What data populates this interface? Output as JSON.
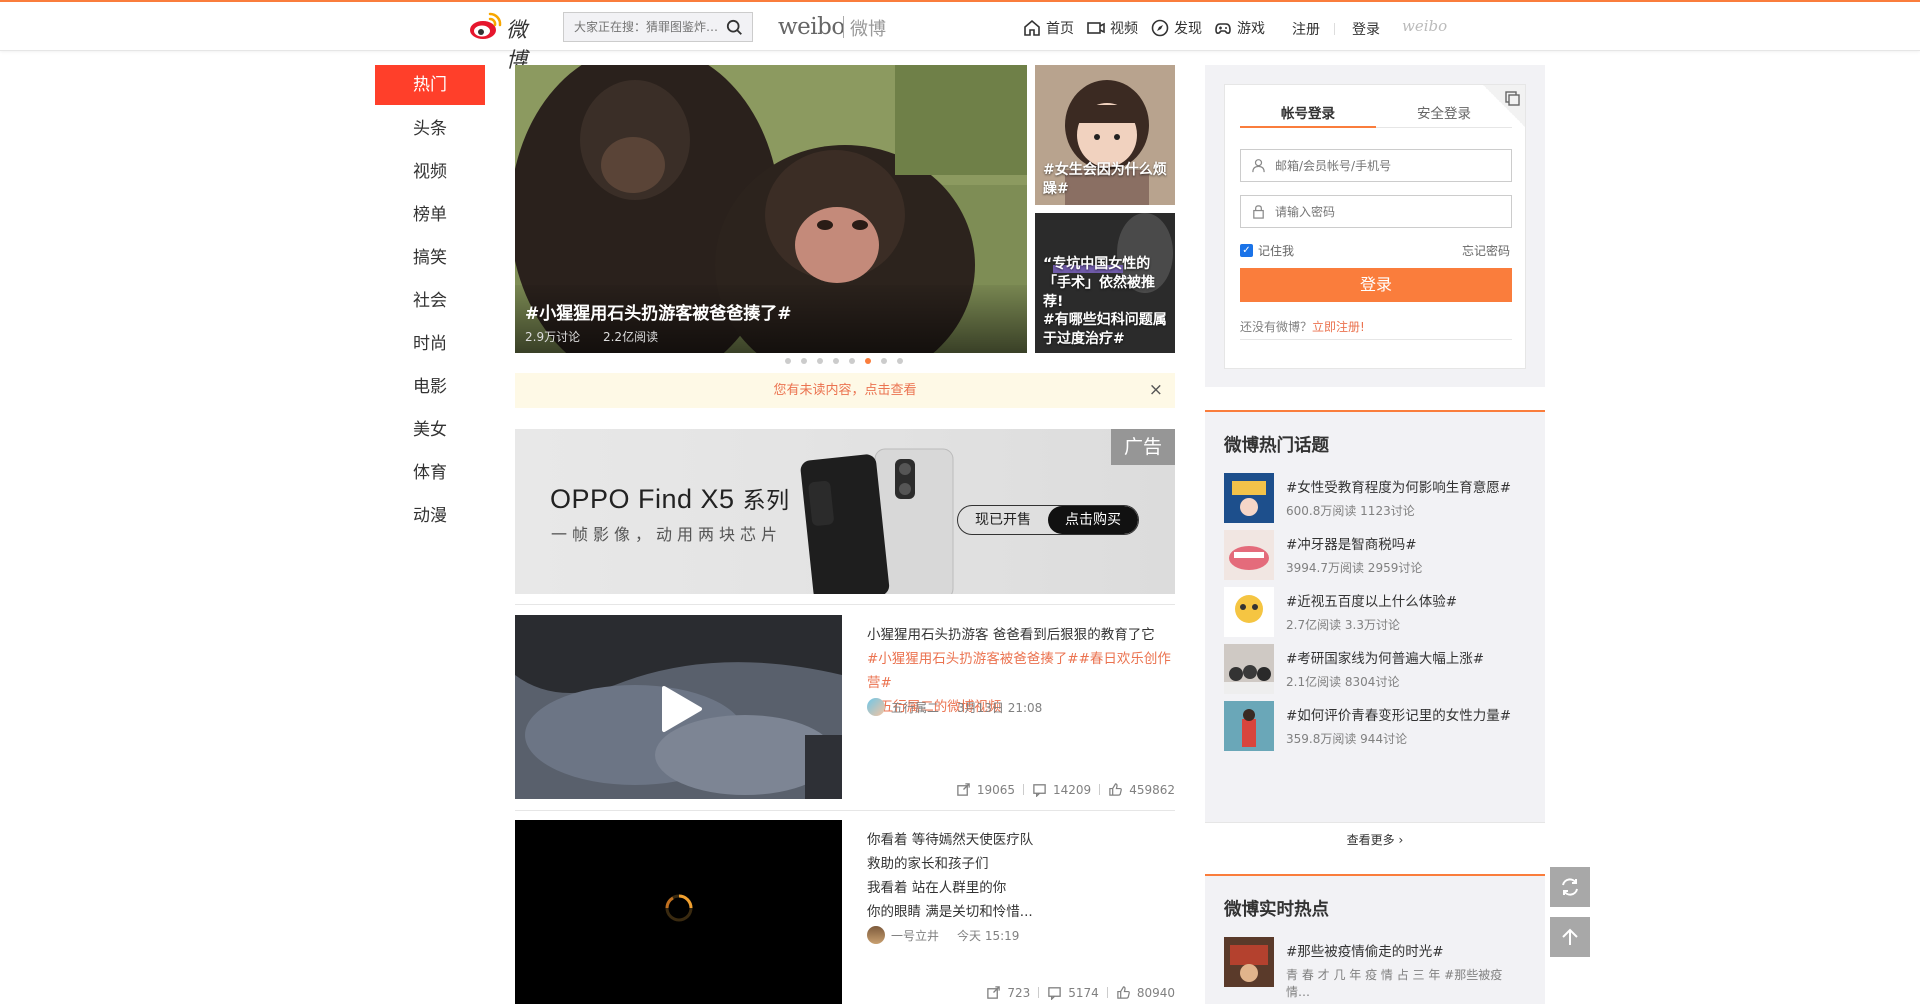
{
  "header": {
    "logo_text": "微博",
    "search_placeholder": "大家正在搜：猜罪图鉴炸…",
    "wordmark": "weibo",
    "wordmark_cn": "微博",
    "nav": [
      {
        "label": "首页",
        "icon": "home-icon"
      },
      {
        "label": "视频",
        "icon": "video-icon"
      },
      {
        "label": "发现",
        "icon": "compass-icon"
      },
      {
        "label": "游戏",
        "icon": "gamepad-icon"
      }
    ],
    "register": "注册",
    "login": "登录",
    "mini_logo": "weibo"
  },
  "leftnav": {
    "items": [
      "热门",
      "头条",
      "视频",
      "榜单",
      "搞笑",
      "社会",
      "时尚",
      "电影",
      "美女",
      "体育",
      "动漫"
    ],
    "active": 0
  },
  "hero": {
    "title": "#小猩猩用石头扔游客被爸爸揍了#",
    "discuss": "2.9万讨论",
    "reads": "2.2亿阅读"
  },
  "side_cards": [
    {
      "caption": "#女生会因为什么烦躁#"
    },
    {
      "caption_quote": "“专坑中国女性的「手术」依然被推荐!",
      "caption": "#有哪些妇科问题属于过度治疗#"
    }
  ],
  "carousel": {
    "count": 8,
    "active": 5
  },
  "unread": {
    "text": "您有未读内容，点击查看",
    "close": "×"
  },
  "ad": {
    "tag": "广告",
    "brand": "OPPO Find X5",
    "brand_suffix": "系列",
    "subtitle": "一帧影像，动用两块芯片",
    "btn1": "现已开售",
    "btn2": "点击购买"
  },
  "feed": [
    {
      "text": "小猩猩用石头扔游客 爸爸看到后狠狠的教育了它",
      "tags": "#小猩猩用石头扔游客被爸爸揍了##春日欢乐创作营#",
      "video_link": "五行属二的微博视频",
      "author": "五行属二",
      "time": "3月13日 21:08",
      "shares": "19065",
      "comments": "14209",
      "likes": "459862"
    },
    {
      "lines": [
        "你看着 等待嫣然天使医疗队",
        "救助的家长和孩子们",
        "我看着 站在人群里的你",
        "你的眼睛 满是关切和怜惜..."
      ],
      "author": "一号立井",
      "time": "今天 15:19",
      "shares": "723",
      "comments": "5174",
      "likes": "80940"
    }
  ],
  "login": {
    "tab_account": "帐号登录",
    "tab_secure": "安全登录",
    "username_placeholder": "邮箱/会员帐号/手机号",
    "password_placeholder": "请输入密码",
    "remember": "记住我",
    "forgot": "忘记密码",
    "submit": "登录",
    "no_account": "还没有微博？",
    "register_now": "立即注册!"
  },
  "hot_topics": {
    "title": "微博热门话题",
    "items": [
      {
        "title": "#女性受教育程度为何影响生育意愿#",
        "meta": "600.8万阅读 1123讨论"
      },
      {
        "title": "#冲牙器是智商税吗#",
        "meta": "3994.7万阅读 2959讨论"
      },
      {
        "title": "#近视五百度以上什么体验#",
        "meta": "2.7亿阅读 3.3万讨论"
      },
      {
        "title": "#考研国家线为何普遍大幅上涨#",
        "meta": "2.1亿阅读 8304讨论"
      },
      {
        "title": "#如何评价青春变形记里的女性力量#",
        "meta": "359.8万阅读 944讨论"
      }
    ],
    "more": "查看更多"
  },
  "realtime": {
    "title": "微博实时热点",
    "items": [
      {
        "title": "#那些被疫情偷走的时光#",
        "meta": "青 春 才 几 年 疫 情 占 三 年 #那些被疫情…"
      }
    ]
  },
  "colors": {
    "accent": "#fa7d3c",
    "hot": "#ff3f2a",
    "link": "#eb7350"
  }
}
